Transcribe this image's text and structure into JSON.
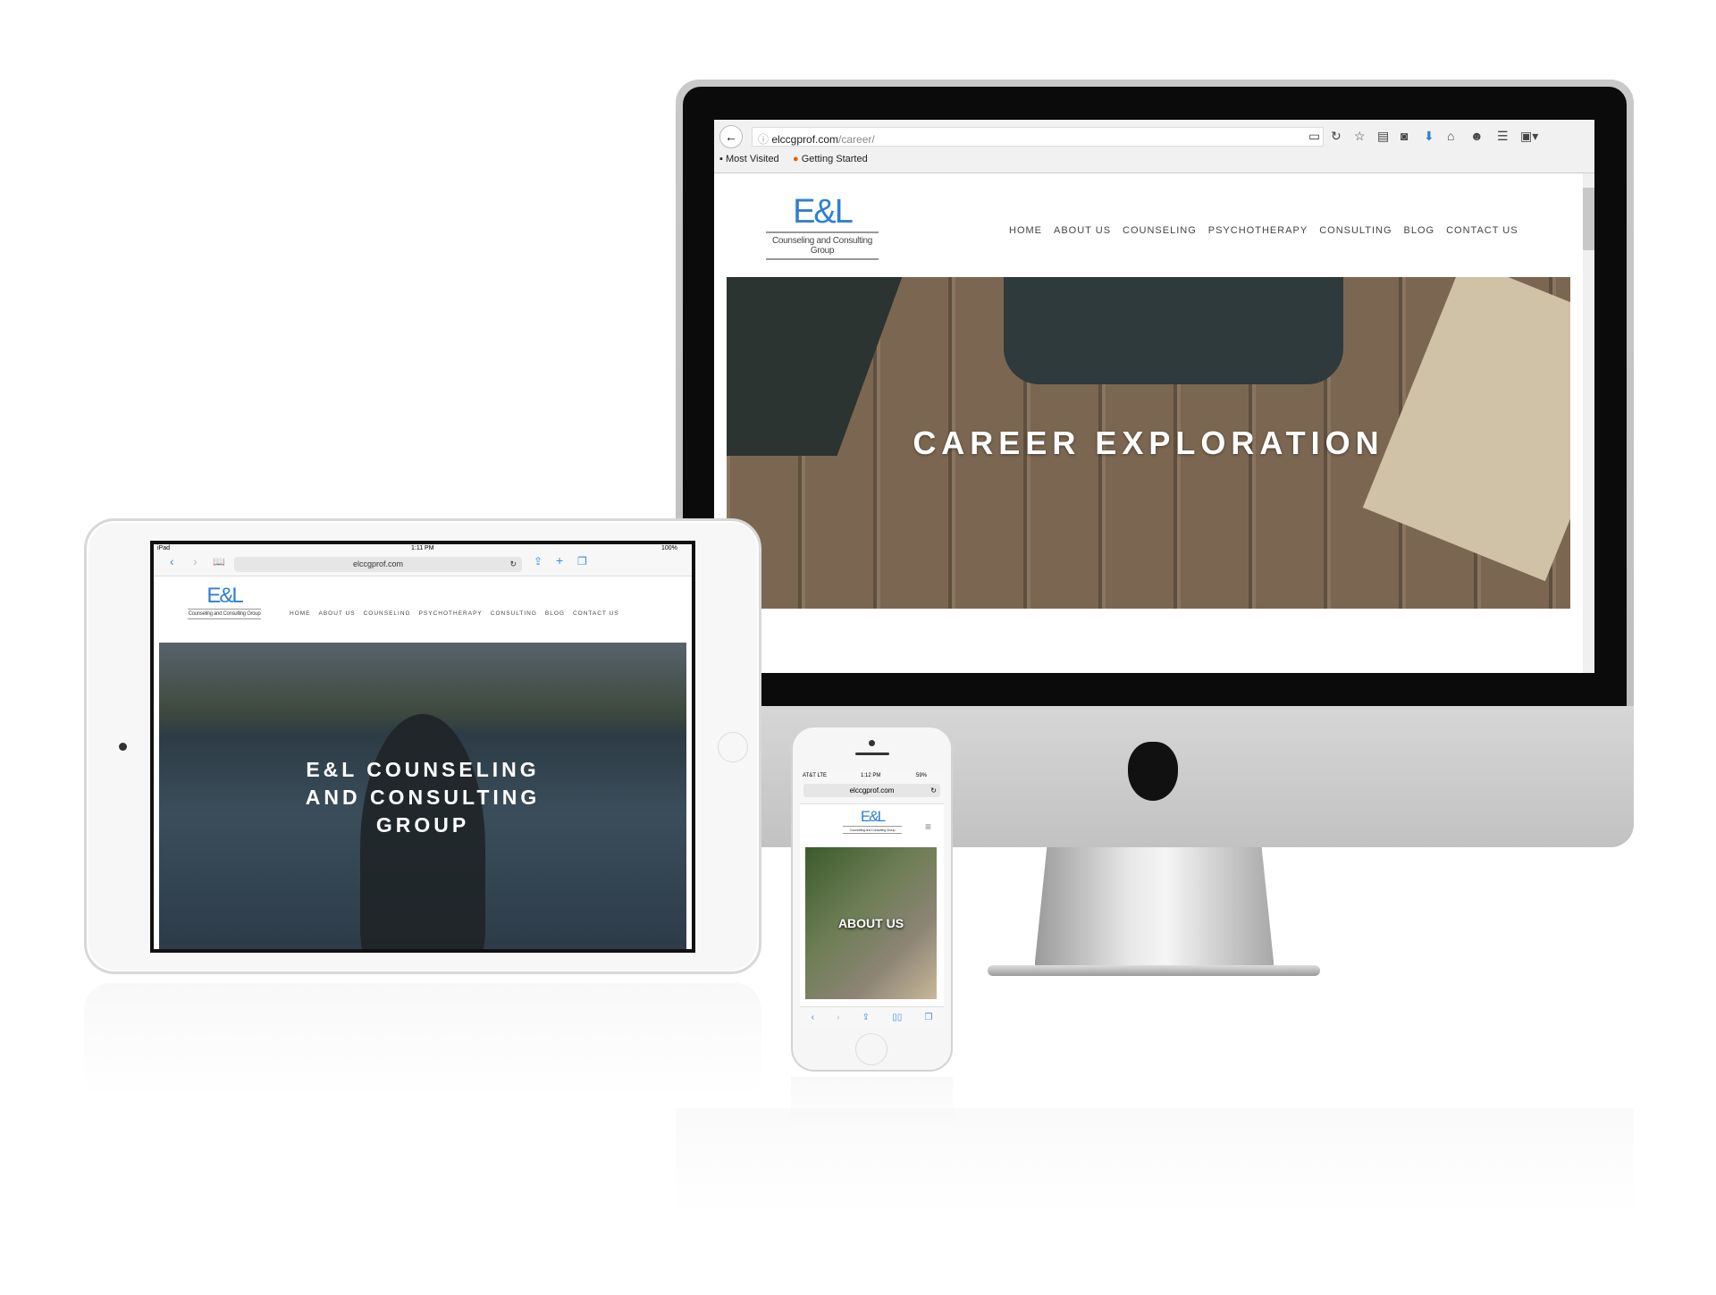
{
  "desktop": {
    "browser": {
      "url_domain": "elccgprof.com",
      "url_path": "/career/",
      "bookmarks": [
        "Most Visited",
        "Getting Started"
      ],
      "toolbar_icons": [
        "back-arrow",
        "info",
        "reader-view",
        "reload",
        "star",
        "clipboard",
        "pocket",
        "download",
        "home",
        "emoji",
        "menu",
        "extension"
      ]
    },
    "logo": {
      "mark": "E&L",
      "tagline": "Counseling and Consulting Group"
    },
    "nav": [
      "HOME",
      "ABOUT US",
      "COUNSELING",
      "PSYCHOTHERAPY",
      "CONSULTING",
      "BLOG",
      "CONTACT US"
    ],
    "hero_title": "CAREER EXPLORATION"
  },
  "tablet": {
    "status": {
      "device": "iPad",
      "time": "1:11 PM",
      "battery": "100%"
    },
    "url": "elccgprof.com",
    "logo": {
      "mark": "E&L",
      "tagline": "Counseling and Consulting Group"
    },
    "nav": [
      "HOME",
      "ABOUT US",
      "COUNSELING",
      "PSYCHOTHERAPY",
      "CONSULTING",
      "BLOG",
      "CONTACT US"
    ],
    "hero_lines": [
      "E&L COUNSELING",
      "AND CONSULTING",
      "GROUP"
    ]
  },
  "phone": {
    "status": {
      "carrier": "AT&T  LTE",
      "time": "1:12 PM",
      "battery": "59%"
    },
    "url": "elccgprof.com",
    "logo": {
      "mark": "E&L",
      "tagline": "Counseling and Consulting Group"
    },
    "hero_title": "ABOUT US"
  },
  "colors": {
    "brand_blue": "#2f7fd1",
    "safari_blue": "#3b8de0"
  }
}
